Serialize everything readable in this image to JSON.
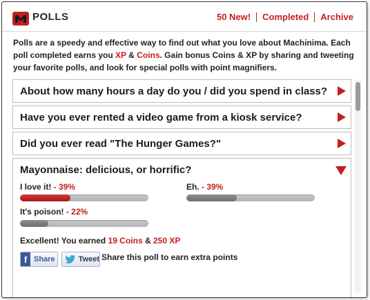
{
  "header": {
    "title": "POLLS",
    "nav": [
      "50 New!",
      "Completed",
      "Archive"
    ]
  },
  "intro": {
    "part1": "Polls are a speedy and effective way to find out what you love about Machinima. Each poll completed earns you ",
    "xp": "XP",
    "amp": " & ",
    "coins": "Coins",
    "part2": ". Gain bonus Coins & XP by sharing and tweeting your favorite polls, and look for special polls with point magnifiers."
  },
  "polls": [
    {
      "question": "About how many hours a day do you / did you spend in class?"
    },
    {
      "question": "Have you ever rented a video game from a kiosk service?"
    },
    {
      "question": "Did you ever read \"The Hunger Games?\""
    }
  ],
  "active_poll": {
    "question": "Mayonnaise: delicious, or horrific?",
    "options": [
      {
        "label": "I love it!",
        "percent_text": " - 39%",
        "value": 0.39,
        "color": "#c41e1e"
      },
      {
        "label": "Eh.",
        "percent_text": " - 39%",
        "value": 0.39,
        "color": "#7a7a7a"
      },
      {
        "label": "It's poison!",
        "percent_text": " - 22%",
        "value": 0.22,
        "color": "#7a7a7a"
      }
    ],
    "earned": {
      "prefix": "Excellent! You earned ",
      "coins": "19 Coins",
      "amp": " & ",
      "xp": "250 XP"
    },
    "share": {
      "facebook": "Share",
      "twitter": "Tweet",
      "text": "Share this poll to earn extra points"
    }
  },
  "colors": {
    "accent": "#c41e1e"
  }
}
